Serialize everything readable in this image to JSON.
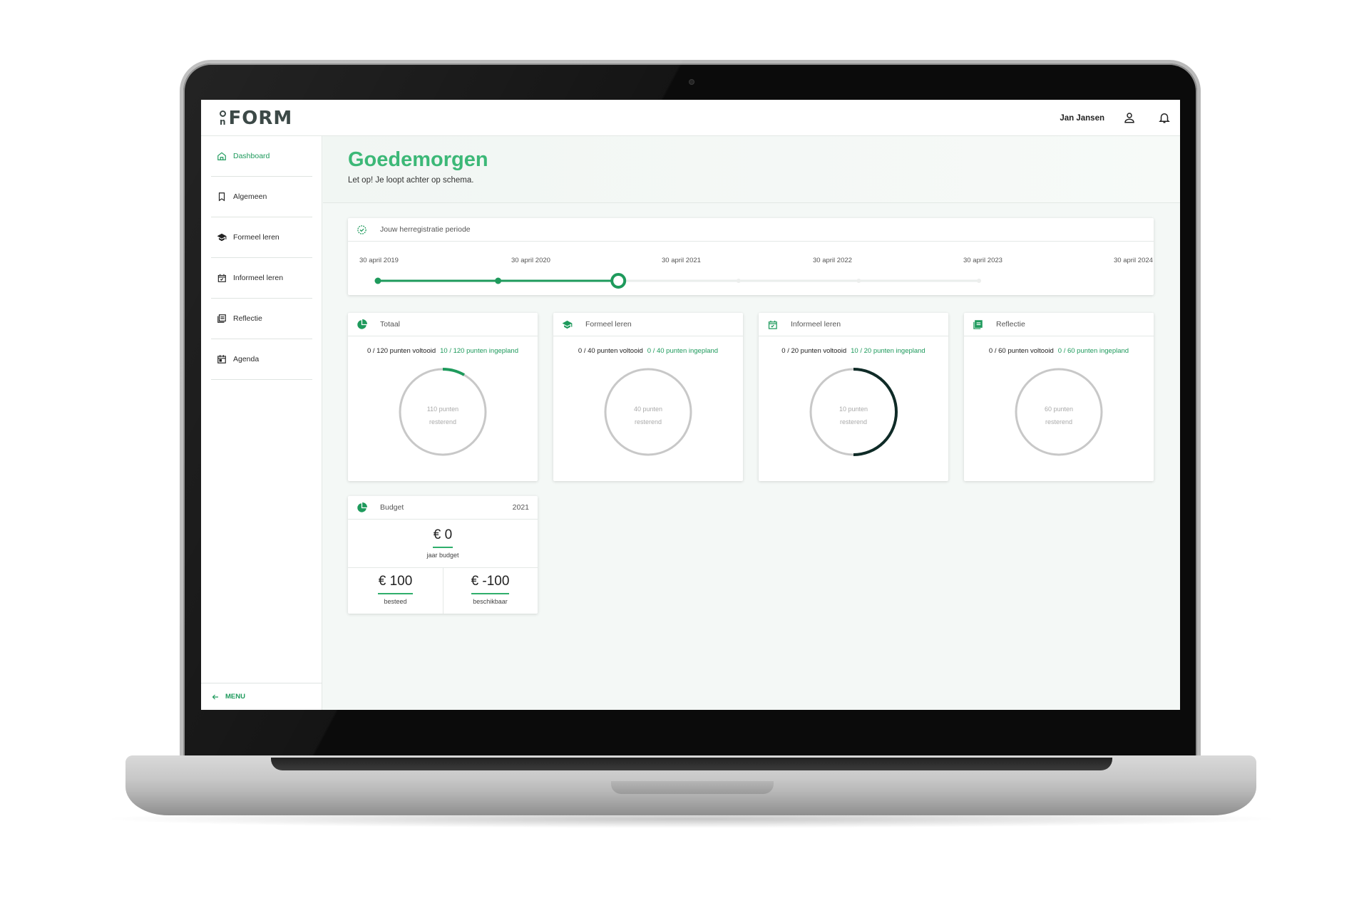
{
  "header": {
    "logo_text": "FORM",
    "logo_mark": "n",
    "username": "Jan Jansen"
  },
  "sidebar": {
    "items": [
      {
        "label": "Dashboard",
        "icon": "home-icon",
        "active": true
      },
      {
        "label": "Algemeen",
        "icon": "bookmark-icon"
      },
      {
        "label": "Formeel leren",
        "icon": "graduation-cap-icon"
      },
      {
        "label": "Informeel leren",
        "icon": "calendar-check-icon"
      },
      {
        "label": "Reflectie",
        "icon": "notes-icon"
      },
      {
        "label": "Agenda",
        "icon": "calendar-icon"
      }
    ],
    "menu_label": "MENU"
  },
  "main": {
    "greeting": "Goedemorgen",
    "subtitle": "Let op! Je loopt achter op schema."
  },
  "timeline": {
    "title": "Jouw herregistratie periode",
    "dates": [
      "30 april 2019",
      "30 april 2020",
      "30 april 2021",
      "30 april 2022",
      "30 april 2023",
      "30 april 2024"
    ],
    "current_index": 2
  },
  "stats": [
    {
      "title": "Totaal",
      "icon": "pie-chart-icon",
      "done": "0 / 120 punten voltooid",
      "planned": "10 / 120 punten ingepland",
      "remaining_value": "110 punten",
      "remaining_label": "resterend",
      "progress": 0.0833,
      "arc_color": "#1e9a5c"
    },
    {
      "title": "Formeel leren",
      "icon": "graduation-cap-icon",
      "done": "0 / 40 punten voltooid",
      "planned": "0 / 40 punten ingepland",
      "remaining_value": "40 punten",
      "remaining_label": "resterend",
      "progress": 0,
      "arc_color": "#1e9a5c"
    },
    {
      "title": "Informeel leren",
      "icon": "calendar-check-icon",
      "done": "0 / 20 punten voltooid",
      "planned": "10 / 20 punten ingepland",
      "remaining_value": "10 punten",
      "remaining_label": "resterend",
      "progress": 0.5,
      "arc_color": "#0f2b27"
    },
    {
      "title": "Reflectie",
      "icon": "notes-icon",
      "done": "0 / 60 punten voltooid",
      "planned": "0 / 60 punten ingepland",
      "remaining_value": "60 punten",
      "remaining_label": "resterend",
      "progress": 0,
      "arc_color": "#1e9a5c"
    }
  ],
  "budget": {
    "title": "Budget",
    "year": "2021",
    "annual_value": "€ 0",
    "annual_label": "jaar budget",
    "spent_value": "€ 100",
    "spent_label": "besteed",
    "available_value": "€ -100",
    "available_label": "beschikbaar"
  },
  "colors": {
    "accent": "#1e9a5c",
    "greeting": "#3cb877",
    "ring_track": "#c8c8c8"
  }
}
